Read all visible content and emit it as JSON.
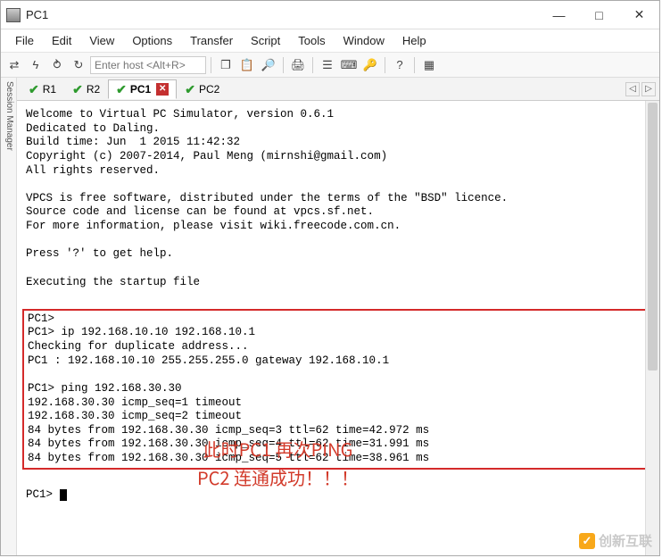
{
  "window": {
    "title": "PC1"
  },
  "menus": [
    "File",
    "Edit",
    "View",
    "Options",
    "Transfer",
    "Script",
    "Tools",
    "Window",
    "Help"
  ],
  "toolbar": {
    "host_placeholder": "Enter host <Alt+R>"
  },
  "sidebar": {
    "label": "Session Manager"
  },
  "tabs": [
    {
      "label": "R1",
      "active": false
    },
    {
      "label": "R2",
      "active": false
    },
    {
      "label": "PC1",
      "active": true,
      "closable": true
    },
    {
      "label": "PC2",
      "active": false
    }
  ],
  "terminal": {
    "intro": "Welcome to Virtual PC Simulator, version 0.6.1\nDedicated to Daling.\nBuild time: Jun  1 2015 11:42:32\nCopyright (c) 2007-2014, Paul Meng (mirnshi@gmail.com)\nAll rights reserved.\n\nVPCS is free software, distributed under the terms of the \"BSD\" licence.\nSource code and license can be found at vpcs.sf.net.\nFor more information, please visit wiki.freecode.com.cn.\n\nPress '?' to get help.\n\nExecuting the startup file\n",
    "boxed": "PC1>\nPC1> ip 192.168.10.10 192.168.10.1\nChecking for duplicate address...\nPC1 : 192.168.10.10 255.255.255.0 gateway 192.168.10.1\n\nPC1> ping 192.168.30.30\n192.168.30.30 icmp_seq=1 timeout\n192.168.30.30 icmp_seq=2 timeout\n84 bytes from 192.168.30.30 icmp_seq=3 ttl=62 time=42.972 ms\n84 bytes from 192.168.30.30 icmp_seq=4 ttl=62 time=31.991 ms\n84 bytes from 192.168.30.30 icmp_seq=5 ttl=62 time=38.961 ms",
    "prompt": "PC1> "
  },
  "annotation": {
    "line1": "此时PC1 再次PING",
    "line2": "PC2 连通成功！！！"
  },
  "watermark": {
    "text": "创新互联"
  }
}
